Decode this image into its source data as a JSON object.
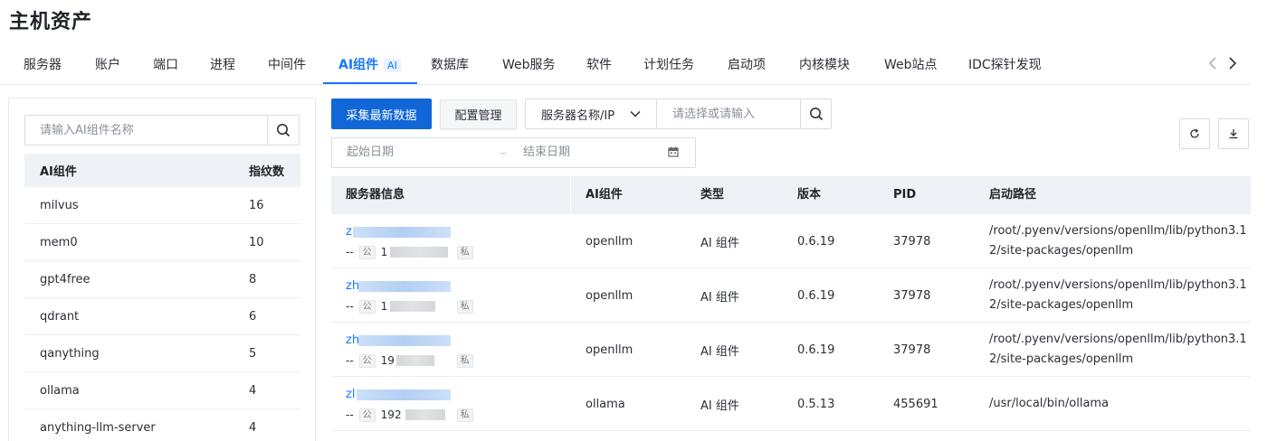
{
  "page_title": "主机资产",
  "tabs": [
    {
      "label": "服务器"
    },
    {
      "label": "账户"
    },
    {
      "label": "端口"
    },
    {
      "label": "进程"
    },
    {
      "label": "中间件"
    },
    {
      "label": "AI组件",
      "badge": "AI",
      "active": true
    },
    {
      "label": "数据库"
    },
    {
      "label": "Web服务"
    },
    {
      "label": "软件"
    },
    {
      "label": "计划任务"
    },
    {
      "label": "启动项"
    },
    {
      "label": "内核模块"
    },
    {
      "label": "Web站点"
    },
    {
      "label": "IDC探针发现"
    }
  ],
  "left_panel": {
    "search_placeholder": "请输入AI组件名称",
    "columns": {
      "name": "AI组件",
      "count": "指纹数"
    },
    "rows": [
      {
        "name": "milvus",
        "count": "16"
      },
      {
        "name": "mem0",
        "count": "10"
      },
      {
        "name": "gpt4free",
        "count": "8"
      },
      {
        "name": "qdrant",
        "count": "6"
      },
      {
        "name": "qanything",
        "count": "5"
      },
      {
        "name": "ollama",
        "count": "4"
      },
      {
        "name": "anything-llm-server",
        "count": "4"
      }
    ]
  },
  "toolbar": {
    "collect_label": "采集最新数据",
    "config_label": "配置管理",
    "filter_select": "服务器名称/IP",
    "filter_placeholder": "请选择或请输入",
    "date_start_placeholder": "起始日期",
    "date_end_placeholder": "结束日期"
  },
  "table": {
    "columns": {
      "server": "服务器信息",
      "component": "AI组件",
      "type": "类型",
      "version": "版本",
      "pid": "PID",
      "path": "启动路径"
    },
    "rows": [
      {
        "server_name": "z",
        "server_prefix": "--",
        "public_tag": "公",
        "ip": "1",
        "private_tag": "私",
        "component": "openllm",
        "type": "AI 组件",
        "version": "0.6.19",
        "pid": "37978",
        "path": "/root/.pyenv/versions/openllm/lib/python3.12/site-packages/openllm"
      },
      {
        "server_name": "zh",
        "server_prefix": "--",
        "public_tag": "公",
        "ip": "1 20",
        "private_tag": "私",
        "component": "openllm",
        "type": "AI 组件",
        "version": "0.6.19",
        "pid": "37978",
        "path": "/root/.pyenv/versions/openllm/lib/python3.12/site-packages/openllm"
      },
      {
        "server_name": "zh",
        "server_prefix": "--",
        "public_tag": "公",
        "ip": "19 20",
        "private_tag": "私",
        "component": "openllm",
        "type": "AI 组件",
        "version": "0.6.19",
        "pid": "37978",
        "path": "/root/.pyenv/versions/openllm/lib/python3.12/site-packages/openllm"
      },
      {
        "server_name": "zl",
        "server_prefix": "--",
        "public_tag": "公",
        "ip": "192 0",
        "private_tag": "私",
        "component": "ollama",
        "type": "AI 组件",
        "version": "0.5.13",
        "pid": "455691",
        "path": "/usr/local/bin/ollama"
      }
    ]
  },
  "colors": {
    "accent": "#1677ff",
    "primary_button": "#1167d8",
    "header_bg": "#eef1f5"
  },
  "icons": {
    "search": "search-icon",
    "refresh": "refresh-icon",
    "download": "download-icon",
    "calendar": "calendar-icon",
    "prev": "chevron-left-icon",
    "next": "chevron-right-icon",
    "dropdown": "chevron-down-icon"
  }
}
